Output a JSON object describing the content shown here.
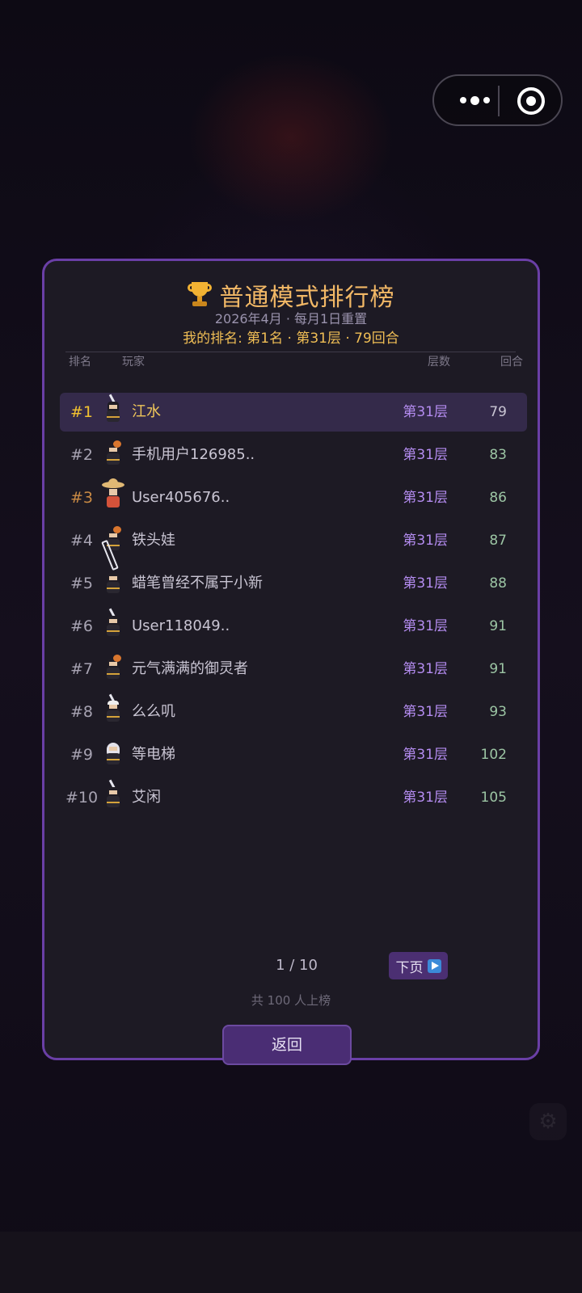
{
  "miniprogram_capsule": {
    "more_icon": "more-dots-icon",
    "close_icon": "target-close-icon"
  },
  "leaderboard": {
    "title": "普通模式排行榜",
    "trophy_icon": "trophy-icon",
    "reset_info": "2026年4月 · 每月1日重置",
    "my_rank": "我的排名: 第1名 · 第31层 · 79回合",
    "columns": {
      "rank": "排名",
      "player": "玩家",
      "floor": "层数",
      "rounds": "回合"
    },
    "rows": [
      {
        "rank": "#1",
        "name": "江水",
        "floor": "第31层",
        "rounds": "79",
        "avatar": "ninja-sword"
      },
      {
        "rank": "#2",
        "name": "手机用户126985..",
        "floor": "第31层",
        "rounds": "83",
        "avatar": "ninja-pot"
      },
      {
        "rank": "#3",
        "name": "User405676..",
        "floor": "第31层",
        "rounds": "86",
        "avatar": "farmer-straw-hat"
      },
      {
        "rank": "#4",
        "name": "铁头娃",
        "floor": "第31层",
        "rounds": "87",
        "avatar": "ninja-pot"
      },
      {
        "rank": "#5",
        "name": "蜡笔曾经不属于小新",
        "floor": "第31层",
        "rounds": "88",
        "avatar": "ninja-big-sword"
      },
      {
        "rank": "#6",
        "name": "User118049..",
        "floor": "第31层",
        "rounds": "91",
        "avatar": "ninja-sword"
      },
      {
        "rank": "#7",
        "name": "元气满满的御灵者",
        "floor": "第31层",
        "rounds": "91",
        "avatar": "ninja-pot"
      },
      {
        "rank": "#8",
        "name": "么么叽",
        "floor": "第31层",
        "rounds": "93",
        "avatar": "ninja-white-hair"
      },
      {
        "rank": "#9",
        "name": "等电梯",
        "floor": "第31层",
        "rounds": "102",
        "avatar": "white-hood"
      },
      {
        "rank": "#10",
        "name": "艾闲",
        "floor": "第31层",
        "rounds": "105",
        "avatar": "ninja-sword"
      }
    ],
    "pagination": {
      "current": "1 / 10",
      "next_label": "下页",
      "next_icon": "play-button-icon"
    },
    "total_text": "共 100  人上榜",
    "back_label": "返回"
  },
  "colors": {
    "panel_border": "#6a3fa6",
    "title": "#f2b866",
    "my_rank": "#f0be55",
    "rank_gold": "#f2c230",
    "rank_bronze": "#c98a44",
    "floor": "#b48cf0",
    "rounds": "#9cc5a4",
    "highlight_row": "#342a4a",
    "button": "#4a2d74"
  }
}
